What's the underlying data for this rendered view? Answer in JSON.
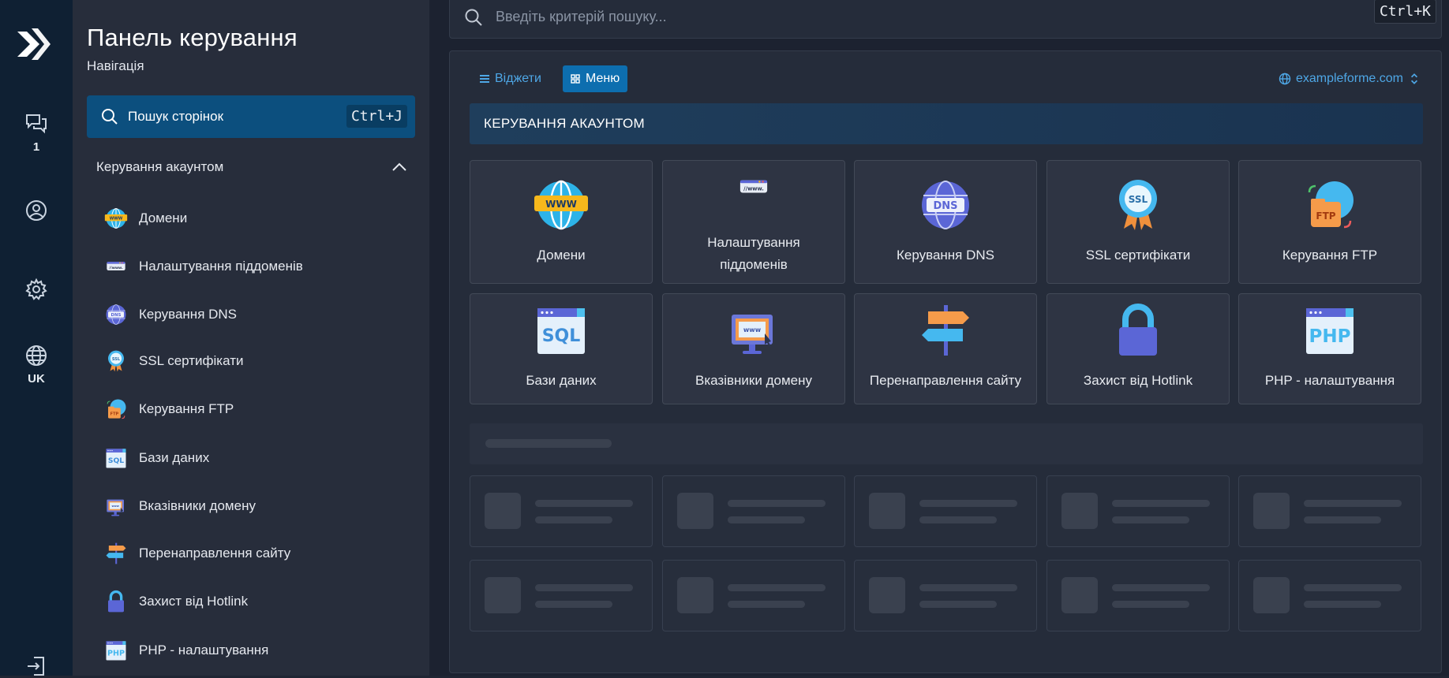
{
  "rail": {
    "chat_count": "1",
    "language": "UK"
  },
  "sidebar": {
    "title": "Панель керування",
    "subtitle": "Навігація",
    "page_search_label": "Пошук сторінок",
    "page_search_shortcut": "Ctrl+J",
    "group_label": "Керування акаунтом",
    "items": [
      {
        "label": "Домени",
        "icon": "globe-www-icon"
      },
      {
        "label": "Налаштування піддоменів",
        "icon": "subdomain-icon"
      },
      {
        "label": "Керування DNS",
        "icon": "dns-icon"
      },
      {
        "label": "SSL сертифікати",
        "icon": "ssl-badge-icon"
      },
      {
        "label": "Керування FTP",
        "icon": "ftp-folder-icon"
      },
      {
        "label": "Бази даних",
        "icon": "sql-database-icon"
      },
      {
        "label": "Вказівники домену",
        "icon": "domain-pointer-icon"
      },
      {
        "label": "Перенаправлення сайту",
        "icon": "redirect-signpost-icon"
      },
      {
        "label": "Захист від Hotlink",
        "icon": "lock-icon"
      },
      {
        "label": "PHP - налаштування",
        "icon": "php-icon"
      }
    ]
  },
  "topbar": {
    "search_placeholder": "Введіть критерій пошуку...",
    "search_shortcut": "Ctrl+K"
  },
  "main": {
    "view_widgets": "Віджети",
    "view_menu": "Меню",
    "domain_selector": "exampleforme.com",
    "section_title": "КЕРУВАННЯ АКАУНТОМ",
    "cards": [
      {
        "label": "Домени"
      },
      {
        "label": "Налаштування піддоменів"
      },
      {
        "label": "Керування DNS"
      },
      {
        "label": "SSL сертифікати"
      },
      {
        "label": "Керування FTP"
      },
      {
        "label": "Бази даних"
      },
      {
        "label": "Вказівники домену"
      },
      {
        "label": "Перенаправлення сайту"
      },
      {
        "label": "Захист від Hotlink"
      },
      {
        "label": "PHP - налаштування"
      }
    ]
  },
  "colors": {
    "accent": "#0d6eaf",
    "link": "#4ea7e6",
    "rail_bg": "#0f2033",
    "sidebar_bg": "#272d3b",
    "main_bg": "#1c2230"
  }
}
